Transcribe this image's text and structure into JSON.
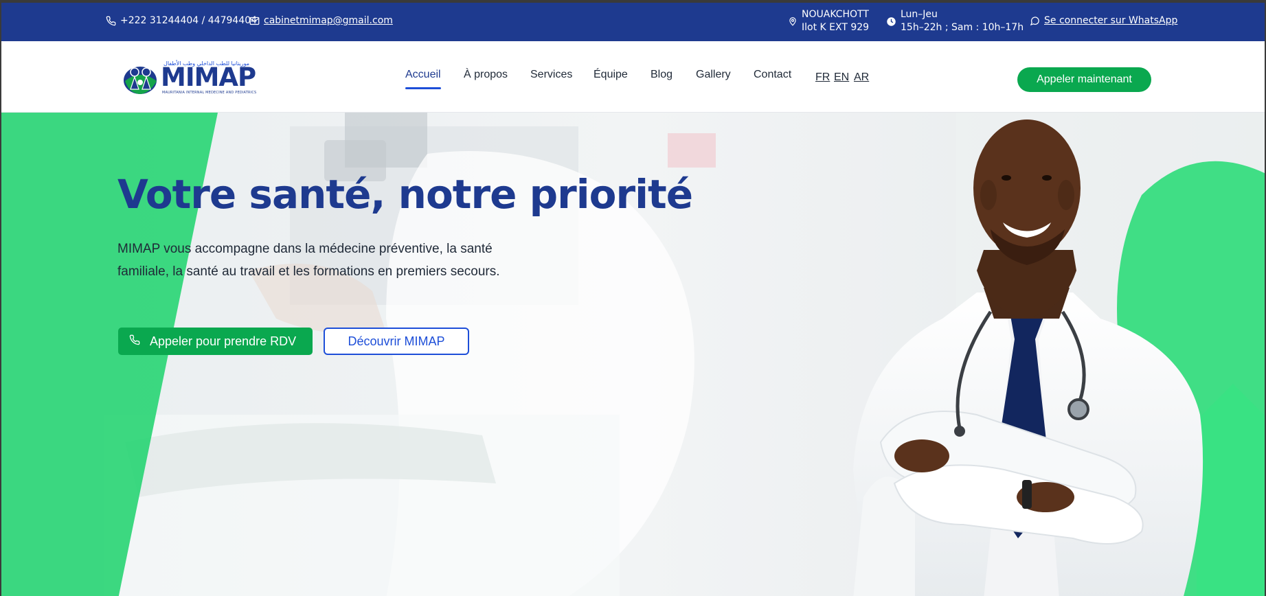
{
  "topbar": {
    "phone": "+222 31244404 / 44794404",
    "email": "cabinetmimap@gmail.com",
    "location_line1": "NOUAKCHOTT",
    "location_line2": "Ilot K EXT 929",
    "hours_line1": "Lun–Jeu",
    "hours_line2": "15h–22h ; Sam : 10h–17h",
    "whatsapp": "Se connecter sur WhatsApp"
  },
  "logo": {
    "wordmark": "MIMAP",
    "arabic": "موريتانيا للطب الداخلي وطب الأطفال",
    "tagline": "MAURITANIA INTERNAL MEDECINE AND PEDIATRICS"
  },
  "nav": {
    "items": [
      "Accueil",
      "À propos",
      "Services",
      "Équipe",
      "Blog",
      "Gallery",
      "Contact"
    ],
    "languages": [
      "FR",
      "EN",
      "AR"
    ],
    "cta": "Appeler maintenant"
  },
  "hero": {
    "title": "Votre santé, notre priorité",
    "text": "MIMAP vous accompagne dans la médecine préventive, la santé familiale, la santé au travail et les formations en premiers secours.",
    "primary_button": "Appeler pour prendre RDV",
    "secondary_button": "Découvrir MIMAP"
  },
  "colors": {
    "topbar": "#1e3a8f",
    "brand_blue": "#1e3a8f",
    "accent_green": "#0aa84f",
    "hero_green": "#22d46f"
  },
  "icons": [
    "phone-icon",
    "mail-icon",
    "location-pin-icon",
    "clock-icon",
    "whatsapp-icon"
  ]
}
